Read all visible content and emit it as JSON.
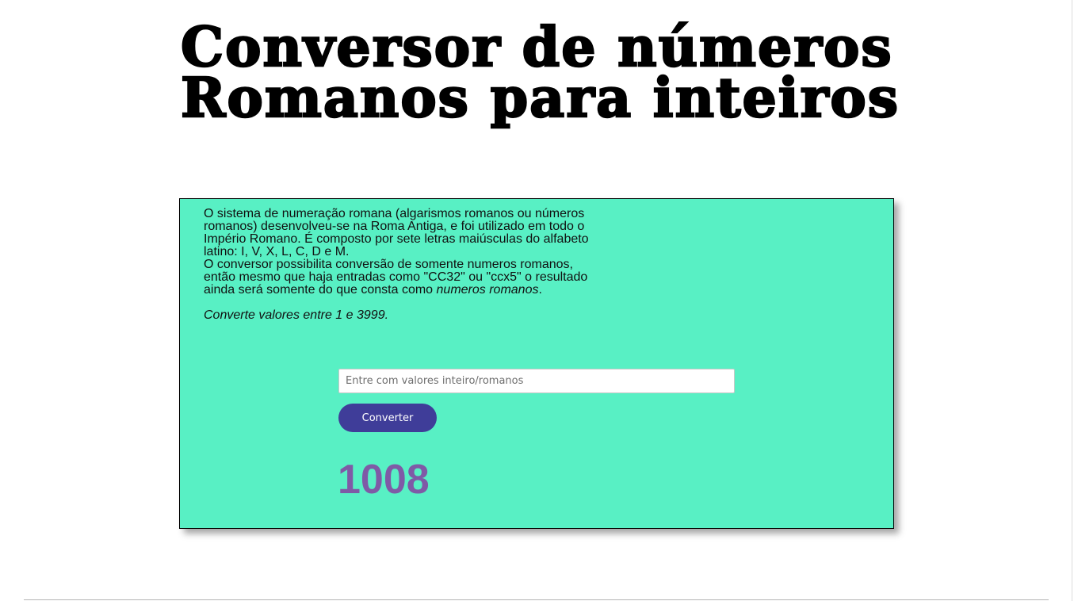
{
  "header": {
    "title_line1": "Conversor de números",
    "title_line2": "Romanos para inteiros"
  },
  "description": {
    "paragraph1": "O sistema de numeração romana (algarismos romanos ou números romanos) desenvolveu-se na Roma Antiga, e foi utilizado em todo o Império Romano. É composto por sete letras maiúsculas do alfabeto latino: I, V, X, L, C, D e M.",
    "paragraph2_start": "O conversor possibilita conversão de somente numeros romanos, então mesmo que haja entradas como \"CC32\" ou \"ccx5\" o resultado ainda será somente do que consta como ",
    "paragraph2_em": "numeros romanos",
    "paragraph2_end": ".",
    "range_note": "Converte valores entre 1 e 3999."
  },
  "converter": {
    "input_placeholder": "Entre com valores inteiro/romanos",
    "input_value": "",
    "button_label": "Converter",
    "result": "1008"
  },
  "colors": {
    "card_background": "#58f0c4",
    "button_background": "#3f3d99",
    "result_text": "#7f5aa6"
  }
}
